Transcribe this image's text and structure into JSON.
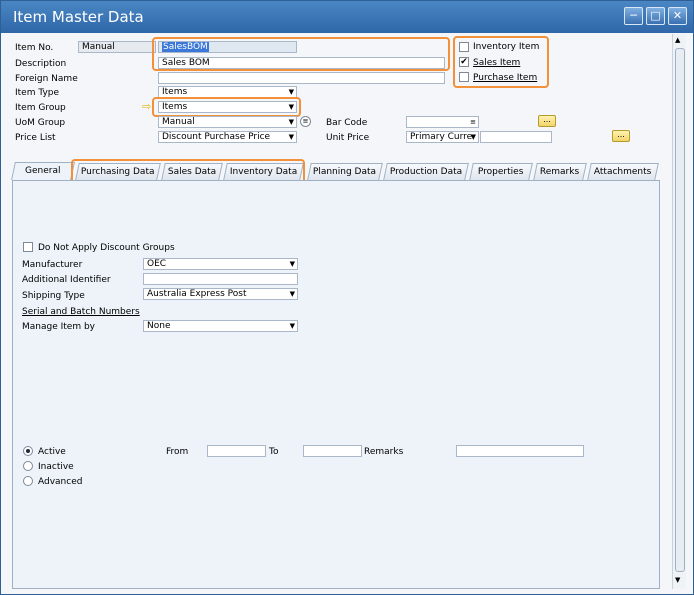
{
  "window": {
    "title": "Item Master Data"
  },
  "header": {
    "item_no_label": "Item No.",
    "item_no_mode": "Manual",
    "item_no_value": "SalesBOM",
    "description_label": "Description",
    "description_value": "Sales BOM",
    "foreign_name_label": "Foreign Name",
    "item_type_label": "Item Type",
    "item_type_value": "Items",
    "item_group_label": "Item Group",
    "item_group_value": "Items",
    "uom_group_label": "UoM Group",
    "uom_group_value": "Manual",
    "price_list_label": "Price List",
    "price_list_value": "Discount Purchase Price",
    "bar_code_label": "Bar Code",
    "unit_price_label": "Unit Price",
    "unit_price_currency": "Primary Curre",
    "inventory_item_label": "Inventory Item",
    "sales_item_label": "Sales Item",
    "purchase_item_label": "Purchase Item",
    "inventory_item_checked": false,
    "sales_item_checked": true,
    "purchase_item_checked": false
  },
  "tabs": [
    {
      "label": "General",
      "active": true
    },
    {
      "label": "Purchasing Data"
    },
    {
      "label": "Sales Data"
    },
    {
      "label": "Inventory Data"
    },
    {
      "label": "Planning Data"
    },
    {
      "label": "Production Data"
    },
    {
      "label": "Properties"
    },
    {
      "label": "Remarks"
    },
    {
      "label": "Attachments"
    }
  ],
  "general": {
    "no_discount_label": "Do Not Apply Discount Groups",
    "manufacturer_label": "Manufacturer",
    "manufacturer_value": "OEC",
    "additional_id_label": "Additional Identifier",
    "shipping_type_label": "Shipping Type",
    "shipping_type_value": "Australia Express Post",
    "serial_batch_label": "Serial and Batch Numbers",
    "manage_item_label": "Manage Item by",
    "manage_item_value": "None",
    "status_active": "Active",
    "status_inactive": "Inactive",
    "status_advanced": "Advanced",
    "from_label": "From",
    "to_label": "To",
    "remarks_label": "Remarks"
  },
  "colors": {
    "highlight": "#f2913a",
    "titlebar": "#2f67a8",
    "selection": "#3b78d8"
  }
}
